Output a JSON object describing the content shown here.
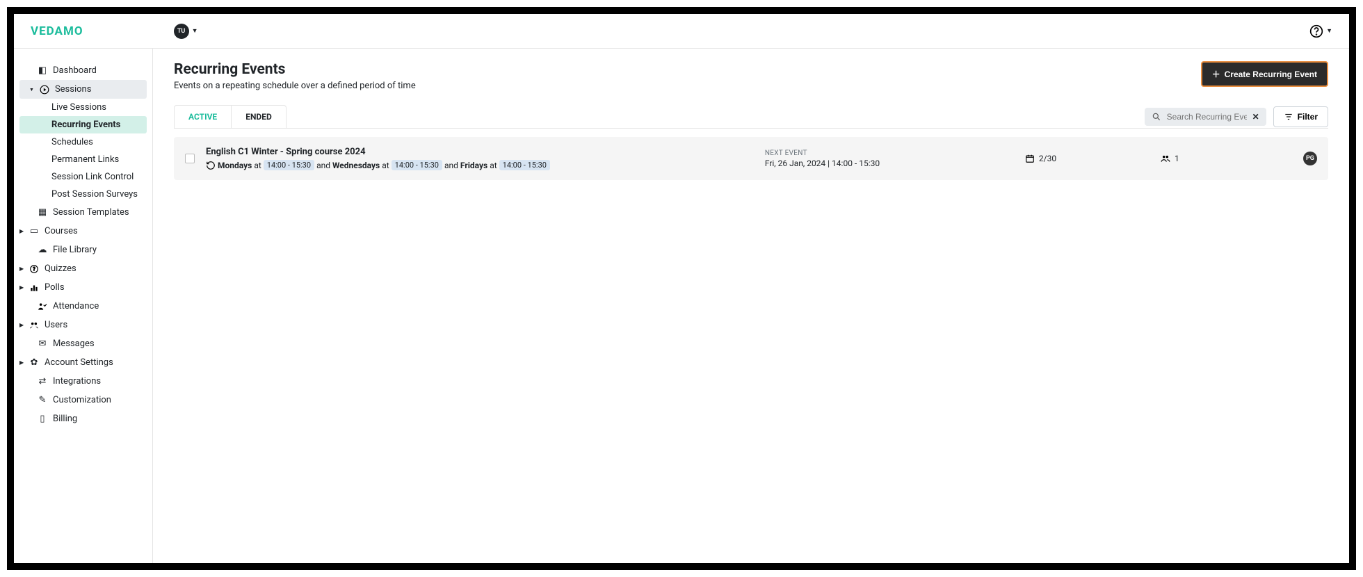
{
  "brand": "VEDAMO",
  "user": {
    "initials": "TU"
  },
  "sidebar": {
    "items": [
      {
        "label": "Dashboard",
        "icon": "dashboard"
      },
      {
        "label": "Sessions",
        "icon": "play",
        "expanded": true
      },
      {
        "label": "Session Templates",
        "icon": "templates"
      },
      {
        "label": "Courses",
        "icon": "courses",
        "expandable": true
      },
      {
        "label": "File Library",
        "icon": "cloud"
      },
      {
        "label": "Quizzes",
        "icon": "help",
        "expandable": true
      },
      {
        "label": "Polls",
        "icon": "poll",
        "expandable": true
      },
      {
        "label": "Attendance",
        "icon": "attendance"
      },
      {
        "label": "Users",
        "icon": "users",
        "expandable": true
      },
      {
        "label": "Messages",
        "icon": "mail"
      },
      {
        "label": "Account Settings",
        "icon": "gear",
        "expandable": true
      },
      {
        "label": "Integrations",
        "icon": "integrations"
      },
      {
        "label": "Customization",
        "icon": "customize"
      },
      {
        "label": "Billing",
        "icon": "billing"
      }
    ],
    "sessionsSub": [
      {
        "label": "Live Sessions"
      },
      {
        "label": "Recurring Events",
        "active": true
      },
      {
        "label": "Schedules"
      },
      {
        "label": "Permanent Links"
      },
      {
        "label": "Session Link Control"
      },
      {
        "label": "Post Session Surveys"
      }
    ]
  },
  "page": {
    "title": "Recurring Events",
    "subtitle": "Events on a repeating schedule over a defined period of time",
    "createLabel": "Create Recurring Event"
  },
  "tabs": [
    {
      "label": "ACTIVE",
      "active": true
    },
    {
      "label": "ENDED"
    }
  ],
  "search": {
    "placeholder": "Search Recurring Events"
  },
  "filterLabel": "Filter",
  "events": [
    {
      "title": "English C1 Winter - Spring course 2024",
      "schedule": {
        "parts": [
          {
            "day": "Mondays",
            "at": "at",
            "time": "14:00 - 15:30"
          },
          {
            "sep": "and",
            "day": "Wednesdays",
            "at": "at",
            "time": "14:00 - 15:30"
          },
          {
            "sep": "and",
            "day": "Fridays",
            "at": "at",
            "time": "14:00 - 15:30"
          }
        ]
      },
      "nextLabel": "NEXT EVENT",
      "nextDate": "Fri, 26 Jan, 2024 | 14:00 - 15:30",
      "progress": "2/30",
      "participants": "1",
      "badge": "PG"
    }
  ]
}
